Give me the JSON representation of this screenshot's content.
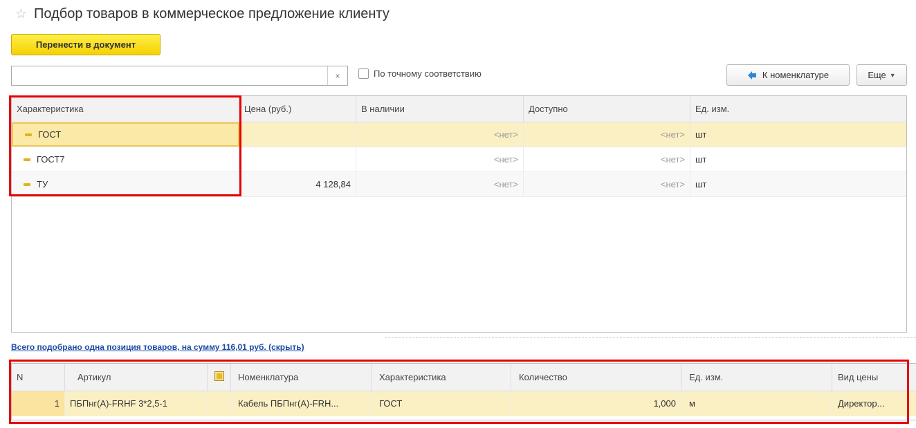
{
  "header": {
    "title": "Подбор товаров в коммерческое предложение клиенту",
    "star_icon": "star-icon"
  },
  "toolbar": {
    "transfer_label": "Перенести в документ",
    "clear_symbol": "×",
    "exact_match_label": "По точному соответствию",
    "exact_match_checked": false,
    "to_nomenclature_label": "К номенклатуре",
    "more_label": "Еще",
    "search": {
      "value": "",
      "placeholder": ""
    }
  },
  "characteristics_table": {
    "columns": [
      "Характеристика",
      "Цена (руб.)",
      "В наличии",
      "Доступно",
      "Ед. изм."
    ],
    "rows": [
      {
        "characteristic": "ГОСТ",
        "price": "",
        "in_stock": "<нет>",
        "available": "<нет>",
        "unit": "шт",
        "selected": true
      },
      {
        "characteristic": "ГОСТ7",
        "price": "",
        "in_stock": "<нет>",
        "available": "<нет>",
        "unit": "шт",
        "selected": false
      },
      {
        "characteristic": "ТУ",
        "price": "4 128,84",
        "in_stock": "<нет>",
        "available": "<нет>",
        "unit": "шт",
        "selected": false
      }
    ]
  },
  "summary": {
    "text": "Всего подобрано одна позиция товаров, на сумму 116,01 руб. (скрыть)"
  },
  "selected_table": {
    "columns": [
      "N",
      "Артикул",
      "",
      "Номенклатура",
      "Характеристика",
      "Количество",
      "Ед. изм.",
      "Вид цены"
    ],
    "rows": [
      {
        "n": "1",
        "article": "ПБПнг(А)-FRHF 3*2,5-1",
        "nomenclature": "Кабель ПБПнг(А)-FRH...",
        "characteristic": "ГОСТ",
        "quantity": "1,000",
        "unit": "м",
        "price_type": "Директор..."
      }
    ]
  },
  "colors": {
    "accent_yellow": "#f5d100",
    "selection": "#fbf0c4",
    "link": "#1d4ba3",
    "annotation_red": "#e60000"
  }
}
